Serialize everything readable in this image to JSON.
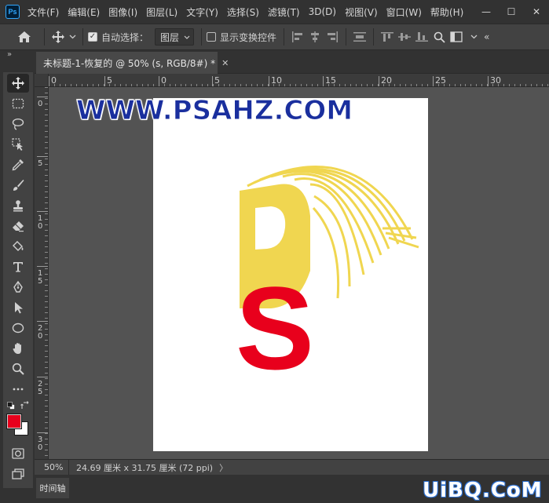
{
  "app": {
    "logo_text": "Ps"
  },
  "menu": {
    "items": [
      "文件(F)",
      "编辑(E)",
      "图像(I)",
      "图层(L)",
      "文字(Y)",
      "选择(S)",
      "滤镜(T)",
      "3D(D)",
      "视图(V)",
      "窗口(W)",
      "帮助(H)"
    ]
  },
  "window_controls": {
    "minimize": "—",
    "maximize": "☐",
    "close": "✕"
  },
  "options_bar": {
    "auto_select_label": "自动选择：",
    "auto_select_checked": true,
    "auto_select_target": "图层",
    "show_transform_label": "显示变换控件",
    "show_transform_checked": false,
    "overflow_label": "«"
  },
  "panel_collapse": "»",
  "document": {
    "tab_title": "未标题-1-恢复的 @ 50% (s, RGB/8#) *",
    "tab_close": "✕"
  },
  "ruler_top_labels": [
    "0",
    "5",
    "0",
    "5",
    "10",
    "15",
    "20",
    "25",
    "30"
  ],
  "ruler_left_labels": [
    "0",
    "5",
    "1 0",
    "1 5",
    "2 0",
    "2 5",
    "3 0"
  ],
  "canvas": {
    "watermark_text": "WWW.PSAHZ.COM",
    "art_letters": [
      "P",
      "S"
    ],
    "colors": {
      "yellow": "#f0d650",
      "red": "#e8001c",
      "watermark_blue": "#1a2f9e"
    }
  },
  "status": {
    "zoom": "50%",
    "doc_info": "24.69 厘米 x 31.75 厘米 (72 ppi)",
    "arrow": "〉"
  },
  "timeline": {
    "tab_label": "时间轴"
  },
  "site_watermark": "UiBQ.CoM",
  "tools": {
    "foreground_color": "#e8001c",
    "background_color": "#ffffff"
  }
}
